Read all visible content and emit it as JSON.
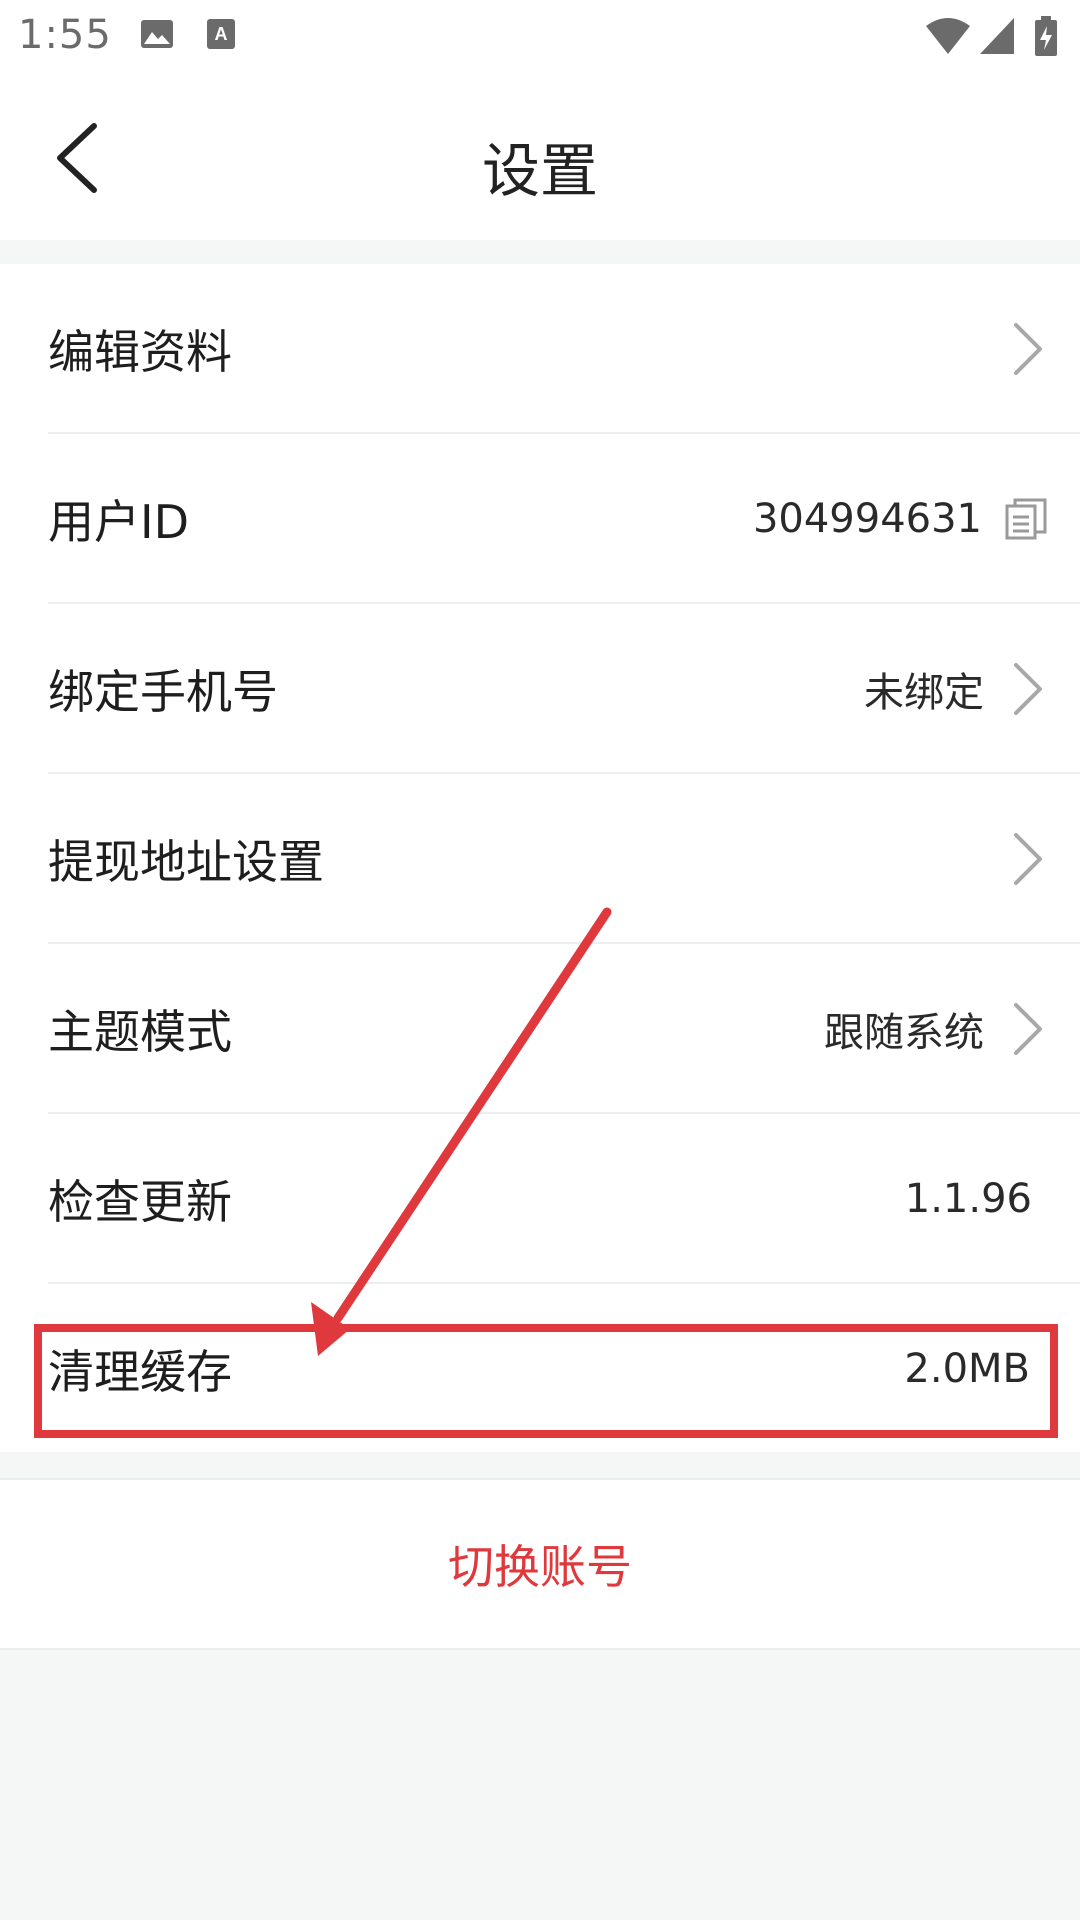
{
  "status_bar": {
    "time": "1:55",
    "icons": [
      "image-icon",
      "keyboard-a-icon",
      "wifi-icon",
      "signal-icon",
      "battery-charging-icon"
    ]
  },
  "header": {
    "title": "设置",
    "back_icon": "chevron-left-icon"
  },
  "settings": {
    "items": [
      {
        "label": "编辑资料",
        "value": "",
        "icon": "chevron-right-icon"
      },
      {
        "label": "用户ID",
        "value": "304994631",
        "icon": "copy-icon"
      },
      {
        "label": "绑定手机号",
        "value": "未绑定",
        "icon": "chevron-right-icon"
      },
      {
        "label": "提现地址设置",
        "value": "",
        "icon": "chevron-right-icon"
      },
      {
        "label": "主题模式",
        "value": "跟随系统",
        "icon": "chevron-right-icon"
      },
      {
        "label": "检查更新",
        "value": "1.1.96",
        "icon": ""
      },
      {
        "label": "清理缓存",
        "value": "2.0MB",
        "icon": ""
      }
    ]
  },
  "switch_account": {
    "label": "切换账号"
  },
  "colors": {
    "accent_red": "#e0393d",
    "background": "#f5f6f6",
    "card": "#ffffff"
  }
}
